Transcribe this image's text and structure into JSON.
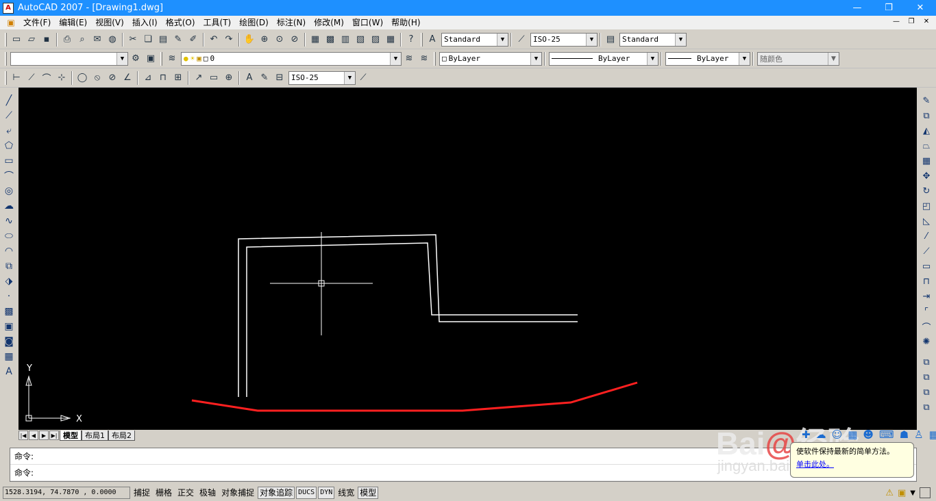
{
  "titlebar": {
    "title": "AutoCAD 2007 - [Drawing1.dwg]",
    "min": "—",
    "max": "❐",
    "close": "✕"
  },
  "menu": {
    "items": [
      "文件(F)",
      "编辑(E)",
      "视图(V)",
      "插入(I)",
      "格式(O)",
      "工具(T)",
      "绘图(D)",
      "标注(N)",
      "修改(M)",
      "窗口(W)",
      "帮助(H)"
    ]
  },
  "toolbar1": {
    "text_style": "Standard",
    "dim_style": "ISO-25",
    "table_style": "Standard"
  },
  "toolbar2": {
    "workspace": "",
    "layer": "0",
    "color": "ByLayer",
    "linetype": "ByLayer",
    "lineweight": "ByLayer",
    "plotstyle": "随颜色"
  },
  "toolbar3": {
    "dim_style": "ISO-25"
  },
  "ucs": {
    "y_label": "Y",
    "x_label": "X"
  },
  "layout_tabs": [
    "模型",
    "布局1",
    "布局2"
  ],
  "command": {
    "line1": "命令:",
    "line2": "命令:"
  },
  "status": {
    "coords": "1528.3194, 74.7870  , 0.0000",
    "buttons": [
      "捕捉",
      "栅格",
      "正交",
      "极轴",
      "对象捕捉",
      "对象追踪",
      "DUCS",
      "DYN",
      "线宽",
      "模型"
    ]
  },
  "balloon": {
    "text": "使软件保持最新的简单方法。",
    "link": "单击此处。"
  },
  "watermark": {
    "logo": "Bai@经验",
    "url": "jingyan.baidu.com"
  },
  "colors": {
    "canvas": "#000000",
    "lines": "#ffffff",
    "red_polyline": "#ff2020",
    "titlebar": "#1e90ff"
  }
}
